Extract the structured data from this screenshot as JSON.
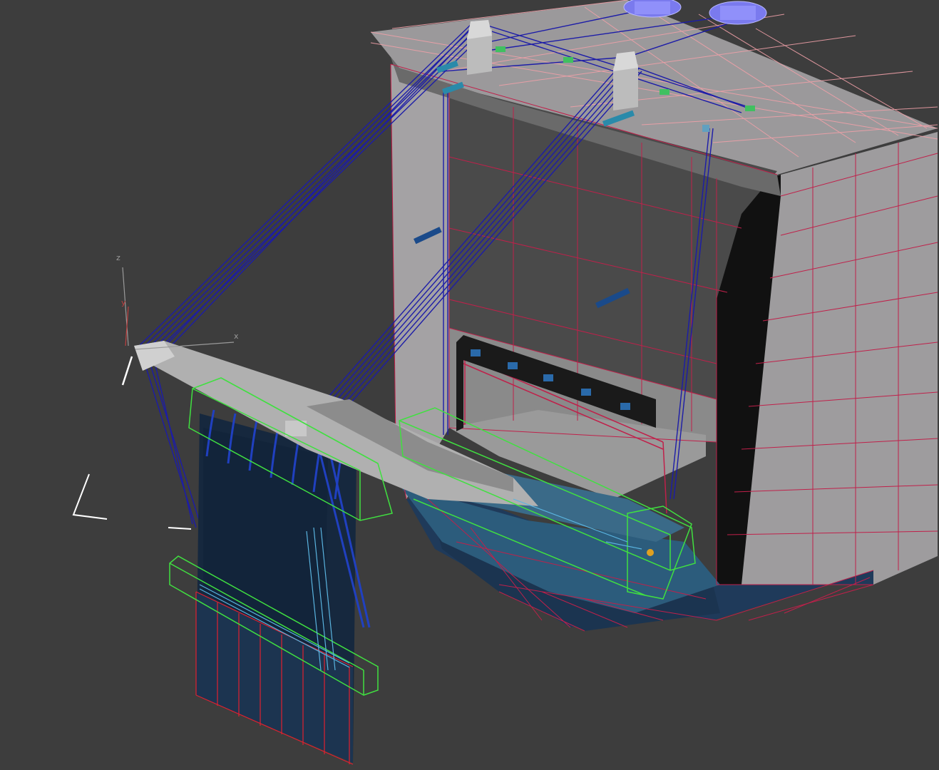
{
  "viewport": {
    "background": "#3d3d3d",
    "view": "perspective"
  },
  "gizmo": {
    "axes": [
      "z",
      "y",
      "x"
    ],
    "colors": {
      "x": "#c04040",
      "y": "#40b040",
      "z": "#9a9a9a",
      "selection": "#ffffff"
    }
  },
  "scene": {
    "objects": [
      {
        "name": "hull-block",
        "color": "#9c9a9c",
        "wire": "#c0204a"
      },
      {
        "name": "deck-railing",
        "color": "#f4a8a8"
      },
      {
        "name": "hull-bottom",
        "color": "#1e3a5c"
      },
      {
        "name": "ramp",
        "color": "#2a5a78"
      },
      {
        "name": "gantry-boom",
        "color": "#a8a8a8"
      },
      {
        "name": "cables",
        "color": "#1a1a9a"
      },
      {
        "name": "gate-panel",
        "color": "#1a2e44"
      },
      {
        "name": "selection-boxes",
        "color": "#40e040"
      },
      {
        "name": "winches",
        "color": "#8a8aff"
      }
    ]
  }
}
